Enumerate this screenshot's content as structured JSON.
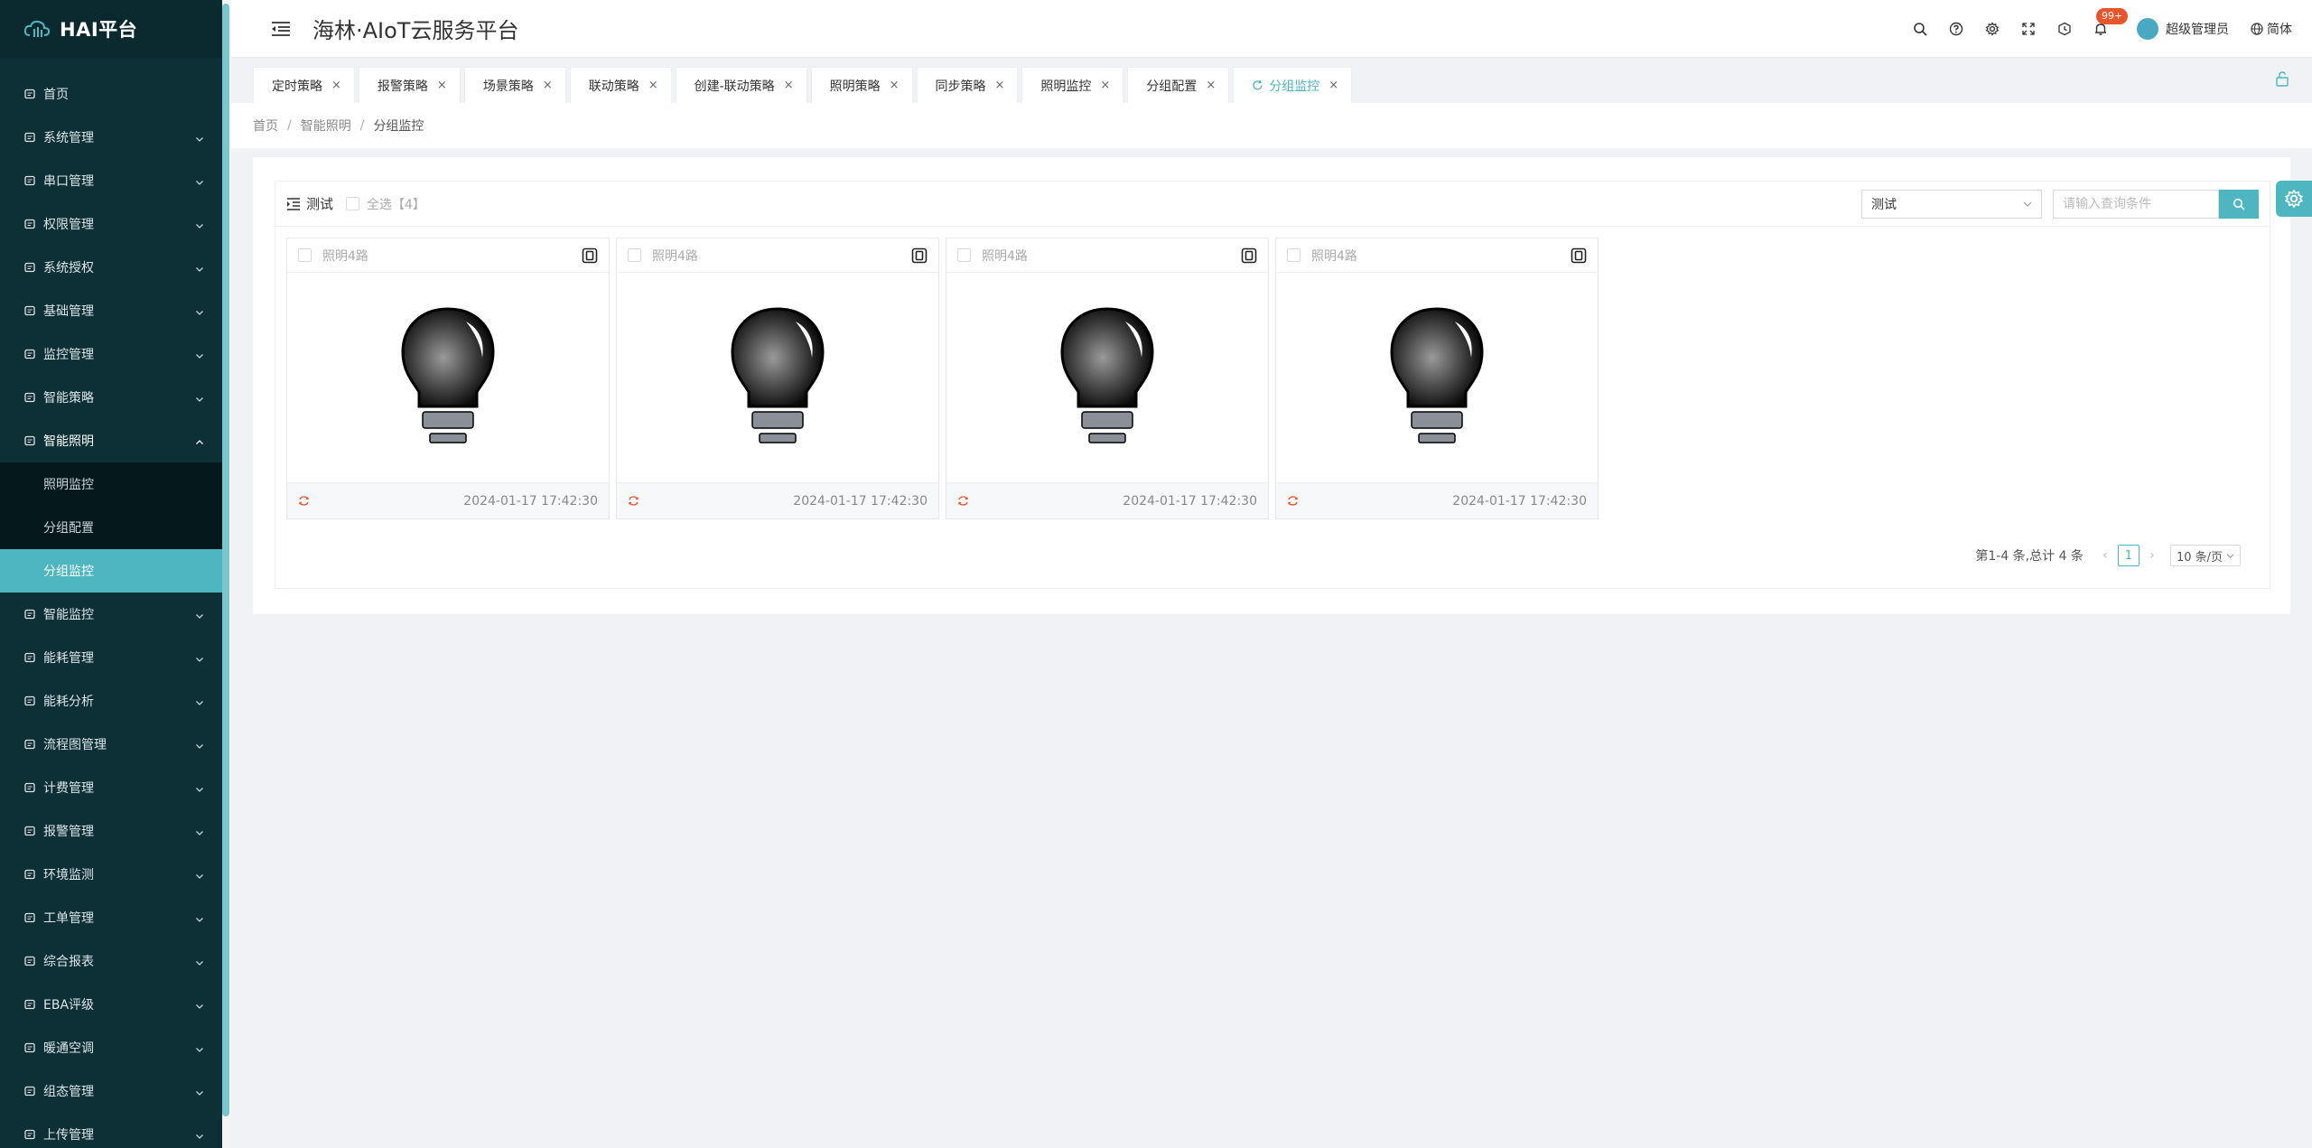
{
  "brand": {
    "name": "HAI平台"
  },
  "header": {
    "title": "海林·AIoT云服务平台",
    "notification_badge": "99+",
    "user_name": "超级管理员",
    "language": "简体"
  },
  "sidebar": {
    "items": [
      {
        "label": "首页",
        "icon": "home-icon",
        "has_arrow": false
      },
      {
        "label": "系统管理",
        "icon": "system-icon",
        "has_arrow": true
      },
      {
        "label": "串口管理",
        "icon": "serial-icon",
        "has_arrow": true
      },
      {
        "label": "权限管理",
        "icon": "shield-icon",
        "has_arrow": true
      },
      {
        "label": "系统授权",
        "icon": "license-icon",
        "has_arrow": true
      },
      {
        "label": "基础管理",
        "icon": "base-icon",
        "has_arrow": true
      },
      {
        "label": "监控管理",
        "icon": "monitor-icon",
        "has_arrow": true
      },
      {
        "label": "智能策略",
        "icon": "location-icon",
        "has_arrow": true
      },
      {
        "label": "智能照明",
        "icon": "bulb-icon",
        "has_arrow": true,
        "open": true
      }
    ],
    "submenu": [
      {
        "label": "照明监控",
        "active": false
      },
      {
        "label": "分组配置",
        "active": false
      },
      {
        "label": "分组监控",
        "active": true
      }
    ],
    "items_after": [
      {
        "label": "智能监控",
        "icon": "camera-icon"
      },
      {
        "label": "能耗管理",
        "icon": "energy-icon"
      },
      {
        "label": "能耗分析",
        "icon": "analysis-icon"
      },
      {
        "label": "流程图管理",
        "icon": "flow-icon"
      },
      {
        "label": "计费管理",
        "icon": "billing-icon"
      },
      {
        "label": "报警管理",
        "icon": "alarm-icon"
      },
      {
        "label": "环境监测",
        "icon": "leaf-icon"
      },
      {
        "label": "工单管理",
        "icon": "workorder-icon"
      },
      {
        "label": "综合报表",
        "icon": "report-icon"
      },
      {
        "label": "EBA评级",
        "icon": "rating-icon"
      },
      {
        "label": "暖通空调",
        "icon": "hvac-icon"
      },
      {
        "label": "组态管理",
        "icon": "config-icon"
      },
      {
        "label": "上传管理",
        "icon": "upload-icon"
      }
    ]
  },
  "tabs": [
    {
      "label": "定时策略",
      "active": false
    },
    {
      "label": "报警策略",
      "active": false
    },
    {
      "label": "场景策略",
      "active": false
    },
    {
      "label": "联动策略",
      "active": false
    },
    {
      "label": "创建-联动策略",
      "active": false
    },
    {
      "label": "照明策略",
      "active": false
    },
    {
      "label": "同步策略",
      "active": false
    },
    {
      "label": "照明监控",
      "active": false
    },
    {
      "label": "分组配置",
      "active": false
    },
    {
      "label": "分组监控",
      "active": true
    }
  ],
  "breadcrumb": [
    "首页",
    "智能照明",
    "分组监控"
  ],
  "toolbar": {
    "group_name": "测试",
    "select_all_label": "全选【4】",
    "select_value": "测试",
    "search_placeholder": "请输入查询条件"
  },
  "cards": [
    {
      "name": "照明4路",
      "time": "2024-01-17 17:42:30"
    },
    {
      "name": "照明4路",
      "time": "2024-01-17 17:42:30"
    },
    {
      "name": "照明4路",
      "time": "2024-01-17 17:42:30"
    },
    {
      "name": "照明4路",
      "time": "2024-01-17 17:42:30"
    }
  ],
  "pagination": {
    "summary": "第1-4 条,总计 4 条",
    "current_page": "1",
    "page_size": "10 条/页"
  },
  "colors": {
    "accent": "#4db6c0",
    "sidebar_bg": "#0d2f36",
    "badge": "#e8542b"
  }
}
